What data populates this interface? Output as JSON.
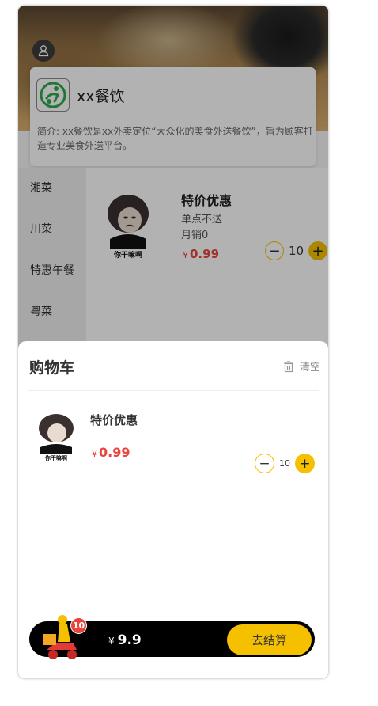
{
  "shop": {
    "name": "xx餐饮",
    "description": "简介: xx餐饮是xx外卖定位“大众化的美食外送餐饮”，旨为顾客打造专业美食外送平台。"
  },
  "categories": [
    "湘菜",
    "川菜",
    "特惠午餐",
    "粤菜"
  ],
  "dish": {
    "title": "特价优惠",
    "note": "单点不送",
    "sales": "月销0",
    "currency": "¥",
    "price": "0.99",
    "quantity": "10",
    "image_caption": "你干嘛啊"
  },
  "cart": {
    "title": "购物车",
    "clear_label": "清空",
    "item": {
      "name": "特价优惠",
      "currency": "¥",
      "price": "0.99",
      "quantity": "10",
      "image_caption": "你干嘛啊"
    }
  },
  "footer": {
    "badge_count": "10",
    "currency": "¥",
    "total": "9.9",
    "checkout_label": "去结算"
  },
  "colors": {
    "accent": "#f5c000",
    "price": "#e8443b",
    "bar": "#000000"
  },
  "icons": [
    "user-icon",
    "shop-logo-icon",
    "trash-icon",
    "minus-icon",
    "plus-icon",
    "delivery-rider-icon"
  ]
}
